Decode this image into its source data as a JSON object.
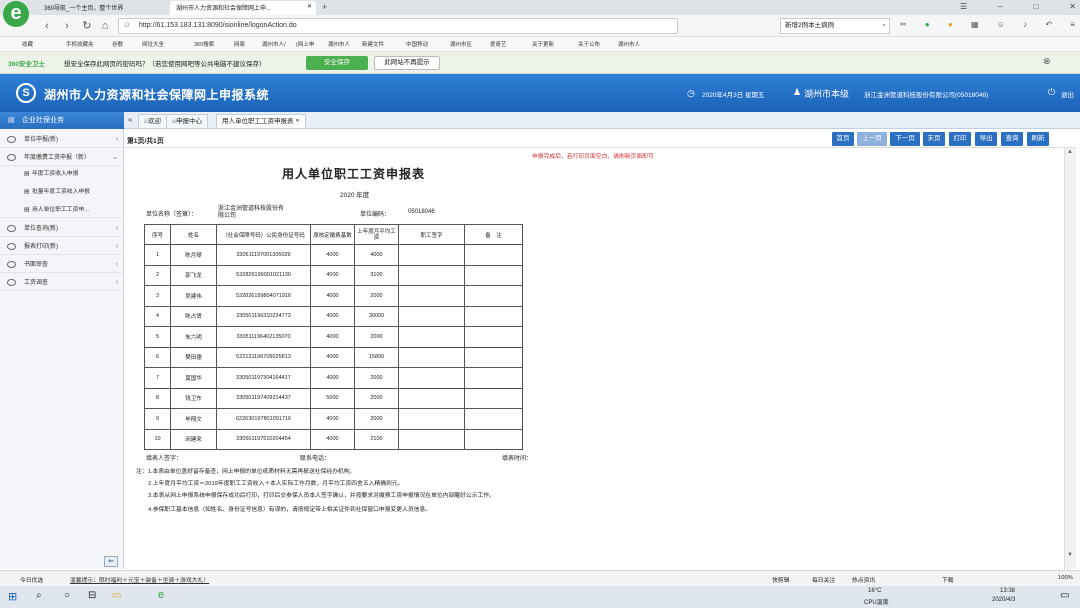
{
  "browser": {
    "tabs": [
      {
        "label": "360导航_一个主页，整个世界"
      },
      {
        "label": "湖州市人力资源和社会保障网上申..."
      }
    ],
    "url": "http://61.153.183.131:8090/sionline/logonAction.do",
    "search_value": "新增2例本土病例",
    "bookmarks": [
      "收藏",
      "手机收藏夹",
      "谷歌",
      "网址大全",
      "360搜索",
      "网易",
      "湖州市人/",
      "(网上申",
      "湖州市人",
      "新建文件",
      "中国移动",
      "湖州市区",
      "爱奇艺",
      "关于更新",
      "关于公布",
      "湖州市人"
    ],
    "save_prompt": "想安全保存此网页的密码吗？（若您使用网吧等公共电脑不建议保存）",
    "save_button": "安全保存",
    "never_button": "此网站不再提示",
    "brand_360": "360安全卫士"
  },
  "app": {
    "title": "湖州市人力资源和社会保障网上申报系统",
    "date": "2020年4月3日 星期五",
    "region": "湖州市本级",
    "company": "浙江金洲管道科技股份有限公司(05018046)",
    "logout": "退出"
  },
  "sidebar": {
    "header": "企业社保业务",
    "items": [
      {
        "label": "单位申报(新)"
      },
      {
        "label": "年度缴费工资申报（新）"
      },
      {
        "label": "年度工资收入申报"
      },
      {
        "label": "批量年度工资收入申报"
      },
      {
        "label": "用人单位职工工资申..."
      },
      {
        "label": "单位查询(新)"
      },
      {
        "label": "报表打印(新)"
      },
      {
        "label": "书面审查"
      },
      {
        "label": "工资调查"
      }
    ]
  },
  "content_tabs": [
    "欢迎",
    "申报中心",
    "用人单位职工工资申报表"
  ],
  "pager": "第1页/共1页",
  "toolbar": [
    "首页",
    "上一页",
    "下一页",
    "末页",
    "打印",
    "导出",
    "查询",
    "刷新"
  ],
  "notice": "申报完成后，若打印页面空白，请刷新页面即可",
  "report": {
    "title": "用人单位职工工资申报表",
    "year": "2020 年度",
    "unit_name_label": "单位名称（签章）：",
    "unit_name": "浙江金洲管道科技股份有限公司",
    "unit_code_label": "单位编码：",
    "unit_code": "05018046",
    "headers": [
      "序号",
      "姓名",
      "（社会保障号码）公民身份证号码",
      "原核定缴费基数",
      "上年度月平均工资",
      "职工签字",
      "备　注"
    ],
    "rows": [
      [
        "1",
        "陈月琴",
        "330511197001305029",
        "4000",
        "4000"
      ],
      [
        "2",
        "郭飞龙",
        "532826199001021130",
        "4000",
        "3100"
      ],
      [
        "3",
        "吴建伟",
        "532826199804071916",
        "4000",
        "2000"
      ],
      [
        "4",
        "陈占贤",
        "330501196310234773",
        "4000",
        "30000"
      ],
      [
        "5",
        "朱六明",
        "330511196402135070",
        "4000",
        "2000"
      ],
      [
        "6",
        "樊田德",
        "522131196709025813",
        "4000",
        "15800"
      ],
      [
        "7",
        "莫国华",
        "330501197304164417",
        "4000",
        "2000"
      ],
      [
        "8",
        "钱卫东",
        "330501197409214437",
        "5000",
        "2000"
      ],
      [
        "9",
        "毕翔文",
        "622630197801091716",
        "4000",
        "2000"
      ],
      [
        "10",
        "闵建来",
        "330501197510204454",
        "4000",
        "2100"
      ]
    ],
    "signer_label": "填表人签字：",
    "phone_label": "联系电话：",
    "time_label": "填表时间：",
    "notes": [
      "注：1.本表由单位盖好留存备查，网上申报的单位纸质材料无需再报送社保经办机构。",
      "2.上年度月平均工资＝2019年度职工工资收入＋本人实际工作月数，月平均工资四舍五入精确到元。",
      "3.本表从网上申报系统申报保存成功后打印，打印后交参保人员本人签字确认，并按要求对缴费工资申报情况在单位内部醒好公示工作。",
      "4.参保职工基本信息（如姓名、身份证号信息）有误的，请按规定带上相关证件到社保窗口申报变更人员信息。"
    ]
  },
  "statusbar": {
    "left": "今日优选",
    "ticker": "温馨提示：限时福利＋元宝＋装备＋坐骑＋游戏大礼！",
    "right_items": [
      "快剪辑",
      "每日关注",
      "热点资讯",
      "下载",
      "100%"
    ]
  },
  "taskbar": {
    "temp": "16°C",
    "cpu": "CPU温度",
    "time": "13:38",
    "date": "2020/4/3"
  }
}
